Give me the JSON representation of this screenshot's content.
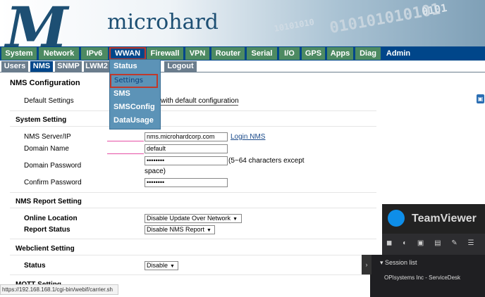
{
  "brand": {
    "logo_word": "microhard"
  },
  "decor": {
    "binary1": "10101010",
    "binary2": "010101010101",
    "binary3": "0101"
  },
  "top_tabs": [
    {
      "label": "System"
    },
    {
      "label": "Network"
    },
    {
      "label": "IPv6"
    },
    {
      "label": "WWAN"
    },
    {
      "label": "Firewall"
    },
    {
      "label": "VPN"
    },
    {
      "label": "Router"
    },
    {
      "label": "Serial"
    },
    {
      "label": "I/O"
    },
    {
      "label": "GPS"
    },
    {
      "label": "Apps"
    },
    {
      "label": "Diag"
    },
    {
      "label": "Admin"
    }
  ],
  "sub_tabs": [
    {
      "label": "Users"
    },
    {
      "label": "NMS"
    },
    {
      "label": "SNMP"
    },
    {
      "label": "LWM2"
    },
    {
      "label": "Logout"
    }
  ],
  "dropdown": [
    "Status",
    "Settings",
    "SMS",
    "SMSConfig",
    "DataUsage"
  ],
  "page": {
    "title": "NMS Configuration",
    "default_settings_label": "Default Settings",
    "default_settings_link": "with default configuration",
    "system_setting": "System Setting",
    "nms_server_label": "NMS Server/IP",
    "nms_server_value": "nms.microhardcorp.com",
    "login_nms": "Login NMS",
    "domain_name_label": "Domain Name",
    "domain_name_value": "default",
    "domain_password_label": "Domain Password",
    "domain_password_value": "••••••••",
    "password_hint": "(5~64 characters except",
    "password_hint2": "space)",
    "confirm_password_label": "Confirm Password",
    "confirm_password_value": "••••••••",
    "report_setting": "NMS Report Setting",
    "online_location_label": "Online Location",
    "online_location_value": "Disable Update Over Network",
    "report_status_label": "Report Status",
    "report_status_value": "Disable NMS Report",
    "webclient_setting": "Webclient Setting",
    "status_label": "Status",
    "status_value": "Disable",
    "mqtt_setting": "MQTT Setting"
  },
  "teamviewer": {
    "title": "TeamViewer",
    "icons": "◼ ◐ ▣ ▤ ✎ ☰",
    "session_list": "Session list",
    "entry": "OPIsystems Inc - ServiceDesk"
  },
  "statusbar": {
    "url": "https://192.168.168.1/cgi-bin/webif/carrier.sh"
  }
}
